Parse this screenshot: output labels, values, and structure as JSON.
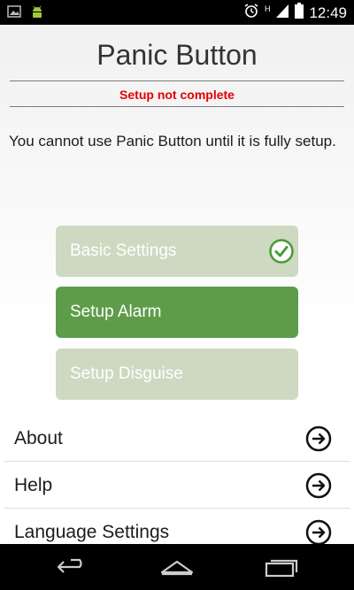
{
  "status_bar": {
    "time": "12:49",
    "signal_label": "H",
    "left_icons": [
      "image-icon",
      "android-icon"
    ],
    "right_icons": [
      "alarm-clock-icon",
      "signal-icon",
      "battery-icon"
    ]
  },
  "header": {
    "title": "Panic Button",
    "status_message": "Setup not complete"
  },
  "intro_text": "You cannot use Panic Button until it is fully setup.",
  "setup_steps": [
    {
      "label": "Basic Settings",
      "state": "completed",
      "icon": "check-circle-icon"
    },
    {
      "label": "Setup Alarm",
      "state": "active"
    },
    {
      "label": "Setup Disguise",
      "state": "inactive"
    }
  ],
  "menu": [
    {
      "label": "About",
      "icon": "arrow-right-circle-icon"
    },
    {
      "label": "Help",
      "icon": "arrow-right-circle-icon"
    },
    {
      "label": "Language Settings",
      "icon": "arrow-right-circle-icon"
    }
  ],
  "nav_bar": {
    "icons": [
      "back-icon",
      "home-icon",
      "recent-apps-icon"
    ]
  },
  "colors": {
    "status_message": "#e30000",
    "step_active": "#5e9c4a",
    "step_inactive": "#cdd9c1",
    "check": "#4a9a36"
  }
}
